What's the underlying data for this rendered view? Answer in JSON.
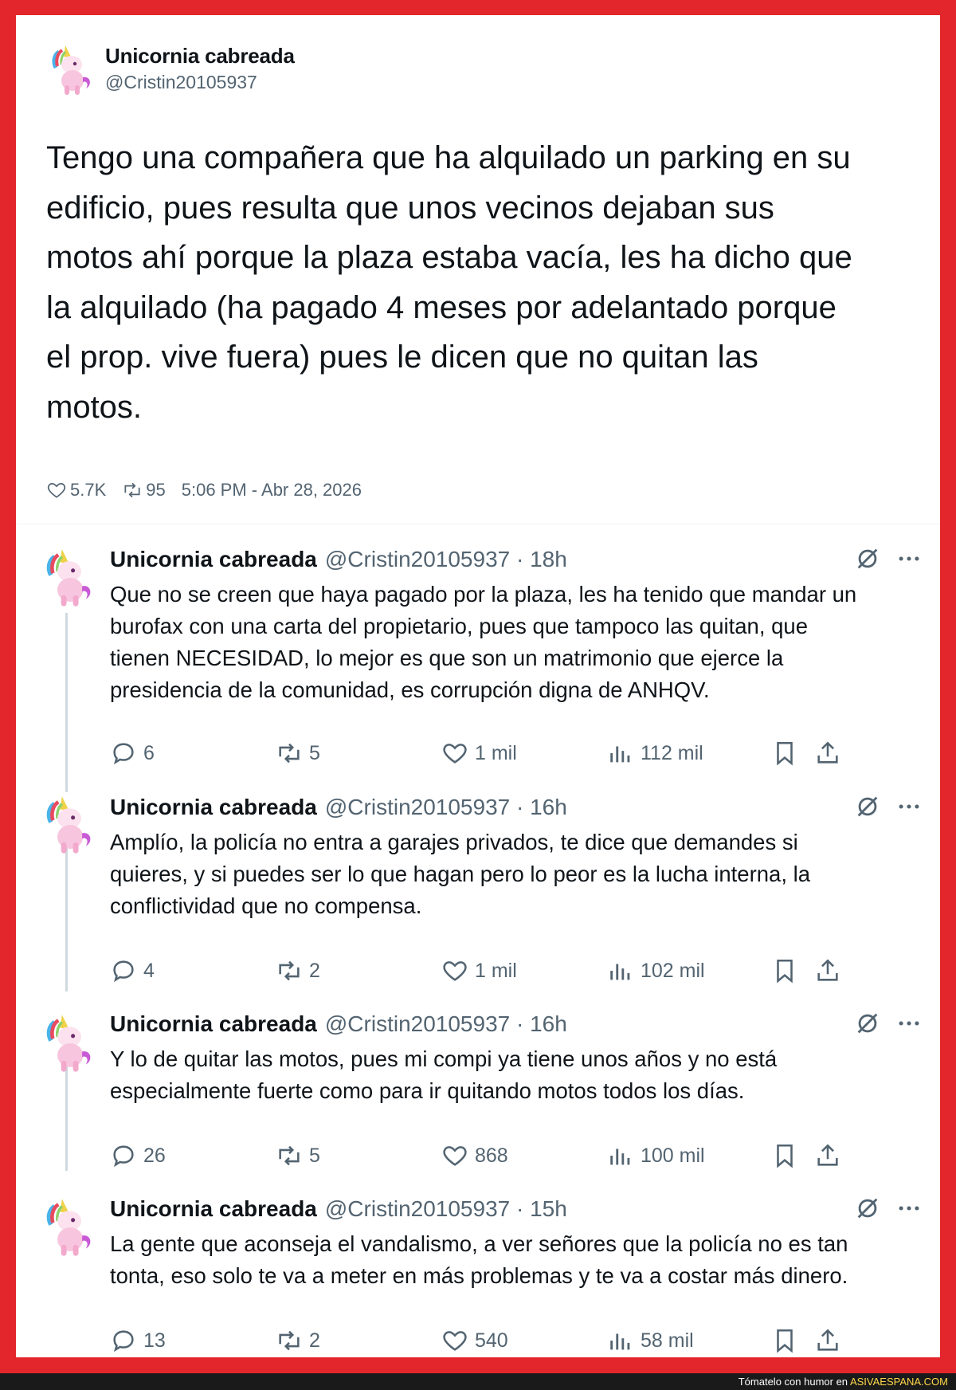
{
  "main_tweet": {
    "author_name": "Unicornia cabreada",
    "handle": "@Cristin20105937",
    "text_lines": [
      "Tengo una compañera que ha alquilado un parking en su",
      "edificio, pues resulta que unos vecinos dejaban sus",
      "motos ahí porque la plaza estaba vacía, les ha dicho que",
      "la alquilado (ha pagado 4 meses por adelantado porque",
      "el prop. vive fuera) pues le dicen que no quitan las",
      "motos."
    ],
    "likes": "5.7K",
    "retweets": "95",
    "timestamp": "5:06 PM - Abr 28, 2026"
  },
  "replies": [
    {
      "author_name": "Unicornia cabreada",
      "handle_time": "@Cristin20105937 · 18h",
      "text_lines": [
        "Que no se creen que haya pagado por la plaza, les ha tenido que mandar un",
        "burofax con una carta del propietario, pues que tampoco las quitan, que",
        "tienen NECESIDAD, lo mejor es que son un matrimonio que ejerce la",
        "presidencia de la comunidad, es corrupción digna de ANHQV."
      ],
      "replies": "6",
      "retweets": "5",
      "likes": "1 mil",
      "views": "112 mil"
    },
    {
      "author_name": "Unicornia cabreada",
      "handle_time": "@Cristin20105937 · 16h",
      "text_lines": [
        "Amplío, la policía no entra a garajes privados, te dice que demandes si",
        "quieres, y si puedes ser lo que hagan pero lo peor es la lucha interna, la",
        "conflictividad que no compensa."
      ],
      "replies": "4",
      "retweets": "2",
      "likes": "1 mil",
      "views": "102 mil"
    },
    {
      "author_name": "Unicornia cabreada",
      "handle_time": "@Cristin20105937 · 16h",
      "text_lines": [
        "Y lo de quitar las motos, pues mi compi ya tiene unos años y no está",
        "especialmente fuerte como para ir quitando motos todos los días."
      ],
      "replies": "26",
      "retweets": "5",
      "likes": "868",
      "views": "100 mil"
    },
    {
      "author_name": "Unicornia cabreada",
      "handle_time": "@Cristin20105937 · 15h",
      "text_lines": [
        "La gente que aconseja el vandalismo, a ver señores que la policía no es tan",
        "tonta, eso solo te va a meter en más problemas y te va a costar más dinero."
      ],
      "replies": "13",
      "retweets": "2",
      "likes": "540",
      "views": "58 mil"
    }
  ],
  "footer": {
    "prefix": "Tómatelo con humor en ",
    "site": "ASIVAESPANA.COM"
  },
  "colors": {
    "frame": "#e3262b",
    "text": "#0f1419",
    "secondary": "#536471",
    "thread_line": "#cfd9de"
  }
}
